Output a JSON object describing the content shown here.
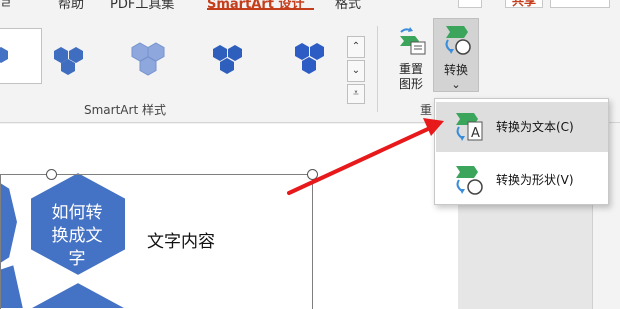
{
  "tabs": {
    "help": "帮助",
    "pdf_tools": "PDF工具集",
    "smartart_design": "SmartArt 设计",
    "format": "格式",
    "share": "共享"
  },
  "ribbon": {
    "smartart_styles_label": "SmartArt 样式",
    "reset_graphic_label_line1": "重置",
    "reset_graphic_label_line2": "图形",
    "convert_label": "转换",
    "convert_caret": "⌄",
    "reset_group_label": "重"
  },
  "menu": {
    "convert_to_text": "转换为文本(C)",
    "convert_to_shapes": "转换为形状(V)"
  },
  "slide": {
    "hexagon_text": "如何转换成文字",
    "side_text": "文字内容"
  },
  "colors": {
    "accent": "#c43e1c",
    "smartart_blue": "#4472c4",
    "annotation_arrow": "#e8191b"
  }
}
